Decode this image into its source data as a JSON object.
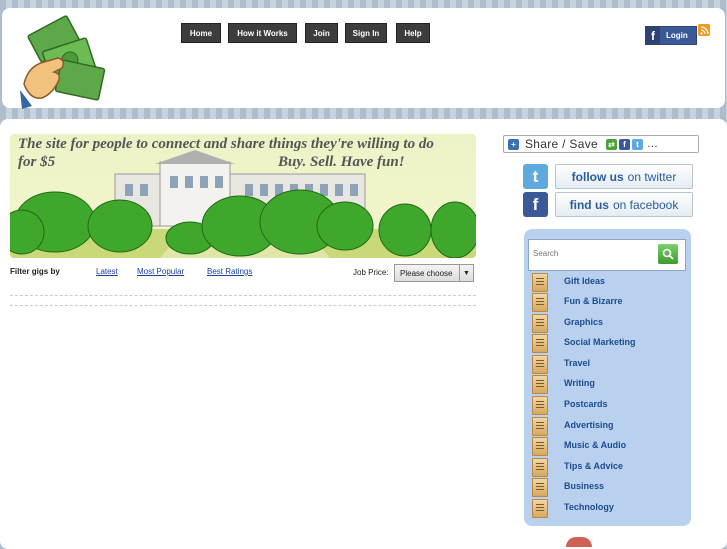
{
  "header": {
    "nav": [
      "Home",
      "How it Works",
      "Join",
      "Sign In",
      "Help"
    ],
    "login_label": "Login",
    "facebook_glyph": "f"
  },
  "banner": {
    "line1": "The site for people to connect and share things they're willing to do",
    "line2a": "for $5",
    "line2b": "Buy. Sell. Have fun!"
  },
  "filter": {
    "label": "Filter gigs by",
    "links": [
      "Latest",
      "Most Popular",
      "Best Ratings"
    ],
    "price_label": "Job Price:",
    "price_value": "Please choose"
  },
  "sidebar": {
    "share_label": "Share / Save",
    "twitter": {
      "bold": "follow us",
      "rest": "on twitter"
    },
    "facebook": {
      "bold": "find us",
      "rest": "on facebook"
    },
    "search_placeholder": "Search",
    "categories": [
      "Gift Ideas",
      "Fun & Bizarre",
      "Graphics",
      "Social Marketing",
      "Travel",
      "Writing",
      "Postcards",
      "Advertising",
      "Music & Audio",
      "Tips & Advice",
      "Business",
      "Technology"
    ]
  },
  "colors": {
    "nav_bg": "#3d3d3d",
    "facebook": "#3b5998",
    "twitter": "#5ea9dd",
    "panel": "#b9d1ef",
    "link": "#1a3fa0"
  },
  "icons": [
    "money-hand-logo",
    "rss-icon",
    "twitter-icon",
    "facebook-icon",
    "search-icon",
    "category-icon"
  ]
}
